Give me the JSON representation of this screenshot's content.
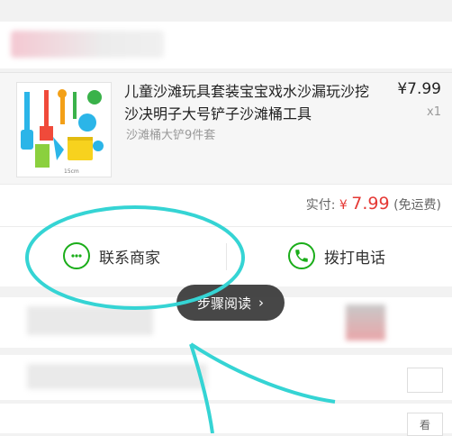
{
  "product": {
    "title": "儿童沙滩玩具套装宝宝戏水沙漏玩沙挖沙决明子大号铲子沙滩桶工具",
    "price": "¥7.99",
    "qty": "x1",
    "spec": "沙滩桶大铲9件套"
  },
  "payment": {
    "label": "实付:",
    "currency": "¥",
    "amount": "7.99",
    "note": "(免运费)"
  },
  "actions": {
    "contact_merchant": "联系商家",
    "call_phone": "拨打电话"
  },
  "toast": {
    "text": "步骤阅读",
    "chevron": "›"
  },
  "lower": {
    "view_button": "看"
  },
  "colors": {
    "accent_green": "#1aad19",
    "price_red": "#e53935",
    "annotation_cyan": "#35d4d4"
  }
}
